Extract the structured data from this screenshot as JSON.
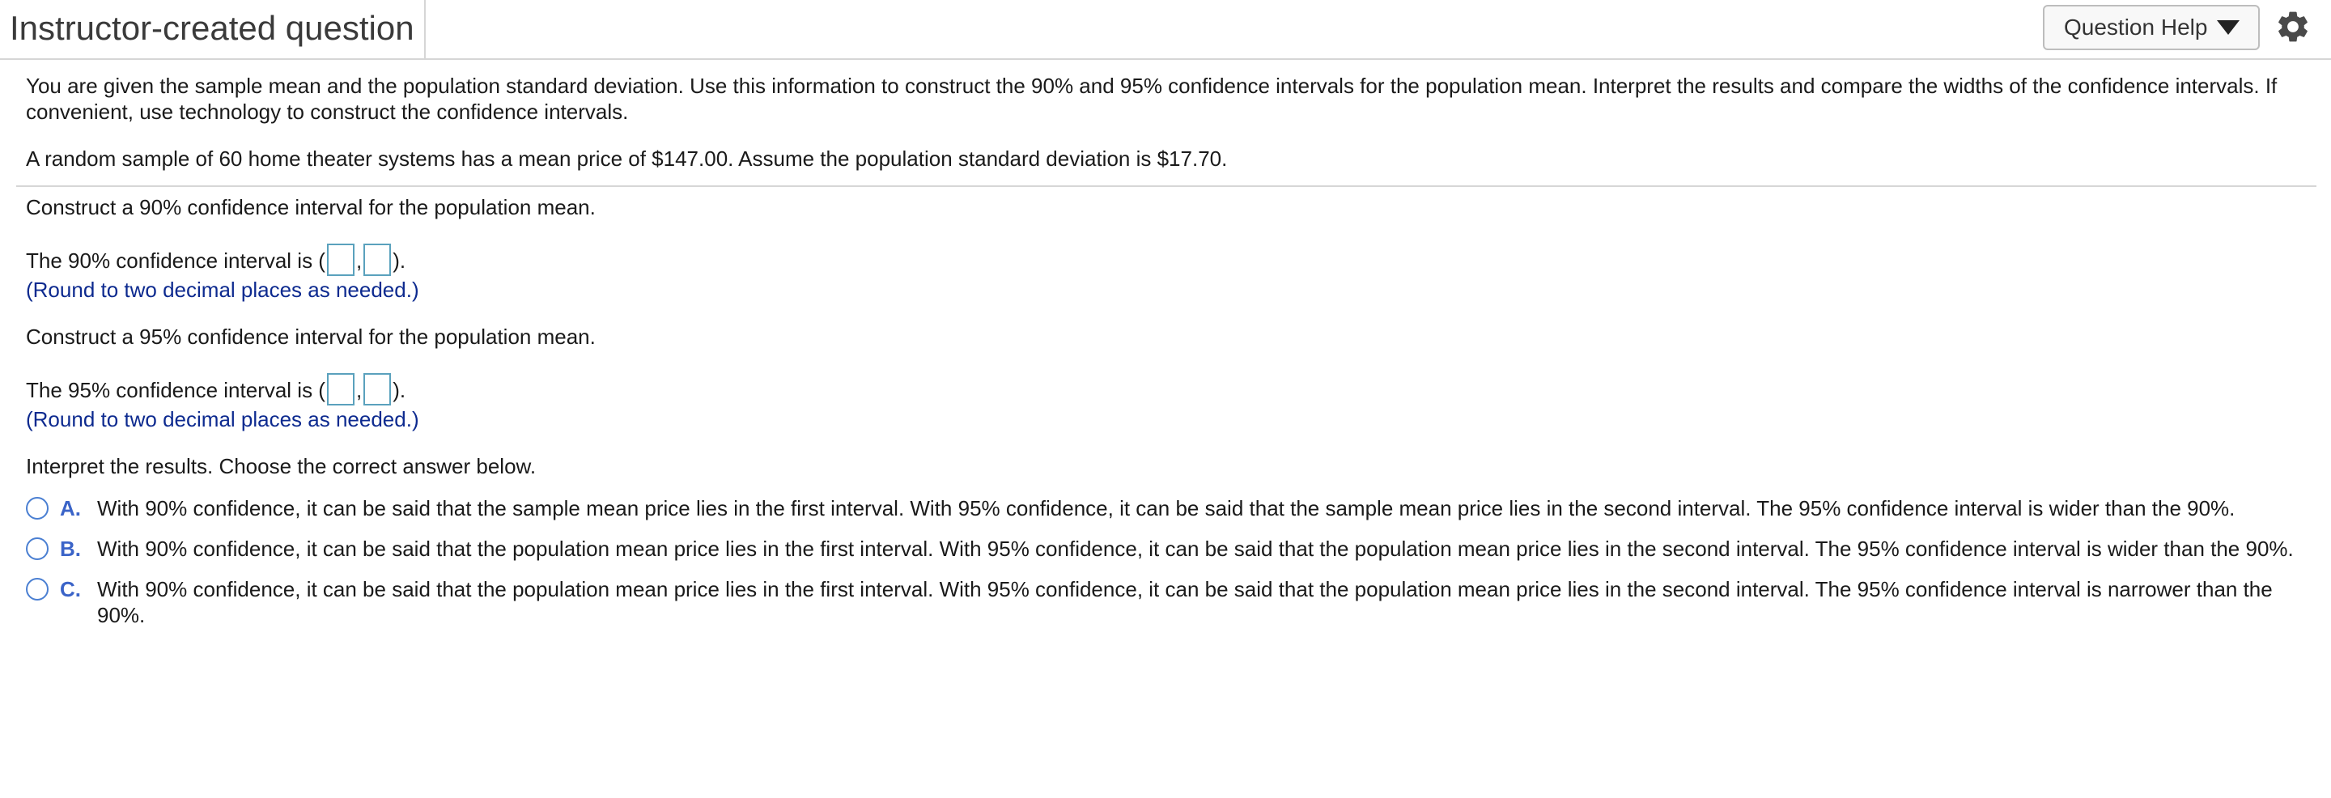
{
  "header": {
    "title": "Instructor-created question",
    "help_label": "Question Help",
    "icons": [
      "caret-down-icon",
      "gear-icon"
    ]
  },
  "problem": {
    "instructions": "You are given the sample mean and the population standard deviation. Use this information to construct the 90% and 95% confidence intervals for the population mean. Interpret the results and compare the widths of the confidence intervals. If convenient, use technology to construct the confidence intervals.",
    "data_statement": "A random sample of 60 home theater systems has a mean price of $147.00. Assume the population standard deviation is $17.70."
  },
  "part1": {
    "prompt": "Construct a 90% confidence interval for the population mean.",
    "answer_prefix": "The 90% confidence interval is (",
    "separator": ",",
    "answer_suffix": ").",
    "hint": "(Round to two decimal places as needed.)"
  },
  "part2": {
    "prompt": "Construct a 95% confidence interval for the population mean.",
    "answer_prefix": "The 95% confidence interval is (",
    "separator": ",",
    "answer_suffix": ").",
    "hint": "(Round to two decimal places as needed.)"
  },
  "part3": {
    "prompt": "Interpret the results. Choose the correct answer below.",
    "options": [
      {
        "letter": "A.",
        "text": "With 90% confidence, it can be said that the sample mean price lies in the first interval. With 95% confidence, it can be said that the sample mean price lies in the second interval. The 95% confidence interval is wider than the 90%."
      },
      {
        "letter": "B.",
        "text": "With 90% confidence, it can be said that the population mean price lies in the first interval. With 95% confidence, it can be said that the population mean price lies in the second interval. The 95% confidence interval is wider than the 90%."
      },
      {
        "letter": "C.",
        "text": "With 90% confidence, it can be said that the population mean price lies in the first interval. With 95% confidence, it can be said that the population mean price lies in the second interval. The 95% confidence interval is narrower than the 90%."
      }
    ]
  }
}
